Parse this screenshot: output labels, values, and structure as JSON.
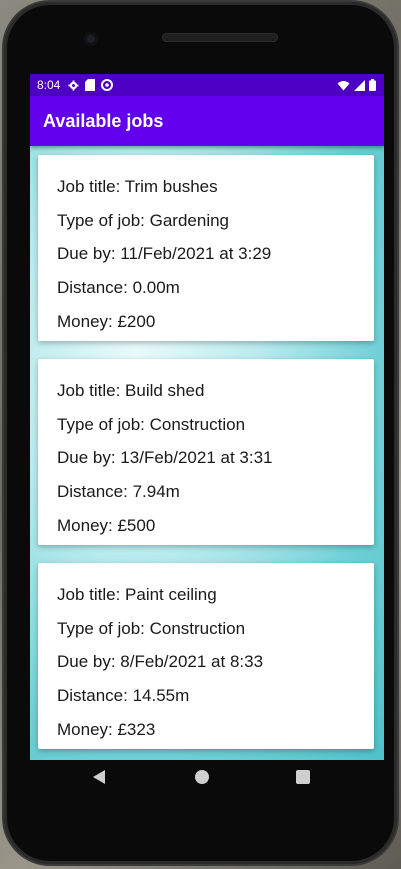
{
  "status": {
    "time": "8:04",
    "left_icons": [
      "gear-icon",
      "sd-card-icon",
      "sync-icon"
    ],
    "right_icons": [
      "wifi-icon",
      "signal-icon",
      "battery-icon"
    ]
  },
  "appbar": {
    "title": "Available jobs"
  },
  "jobs": [
    {
      "title": "Job title: Trim bushes",
      "type": "Type of job: Gardening",
      "due": "Due by: 11/Feb/2021 at 3:29",
      "distance": "Distance: 0.00m",
      "money": "Money: £200"
    },
    {
      "title": "Job title: Build shed",
      "type": "Type of job: Construction",
      "due": "Due by: 13/Feb/2021 at 3:31",
      "distance": "Distance: 7.94m",
      "money": "Money: £500"
    },
    {
      "title": "Job title: Paint ceiling",
      "type": "Type of job: Construction",
      "due": "Due by: 8/Feb/2021 at 8:33",
      "distance": "Distance: 14.55m",
      "money": "Money: £323"
    }
  ],
  "navigation": {
    "icons": [
      "back-icon",
      "home-icon",
      "recents-icon"
    ]
  },
  "colors": {
    "status_bar": "#4d00c4",
    "app_bar": "#6200ee",
    "background_accent": "#5fc9cf"
  }
}
